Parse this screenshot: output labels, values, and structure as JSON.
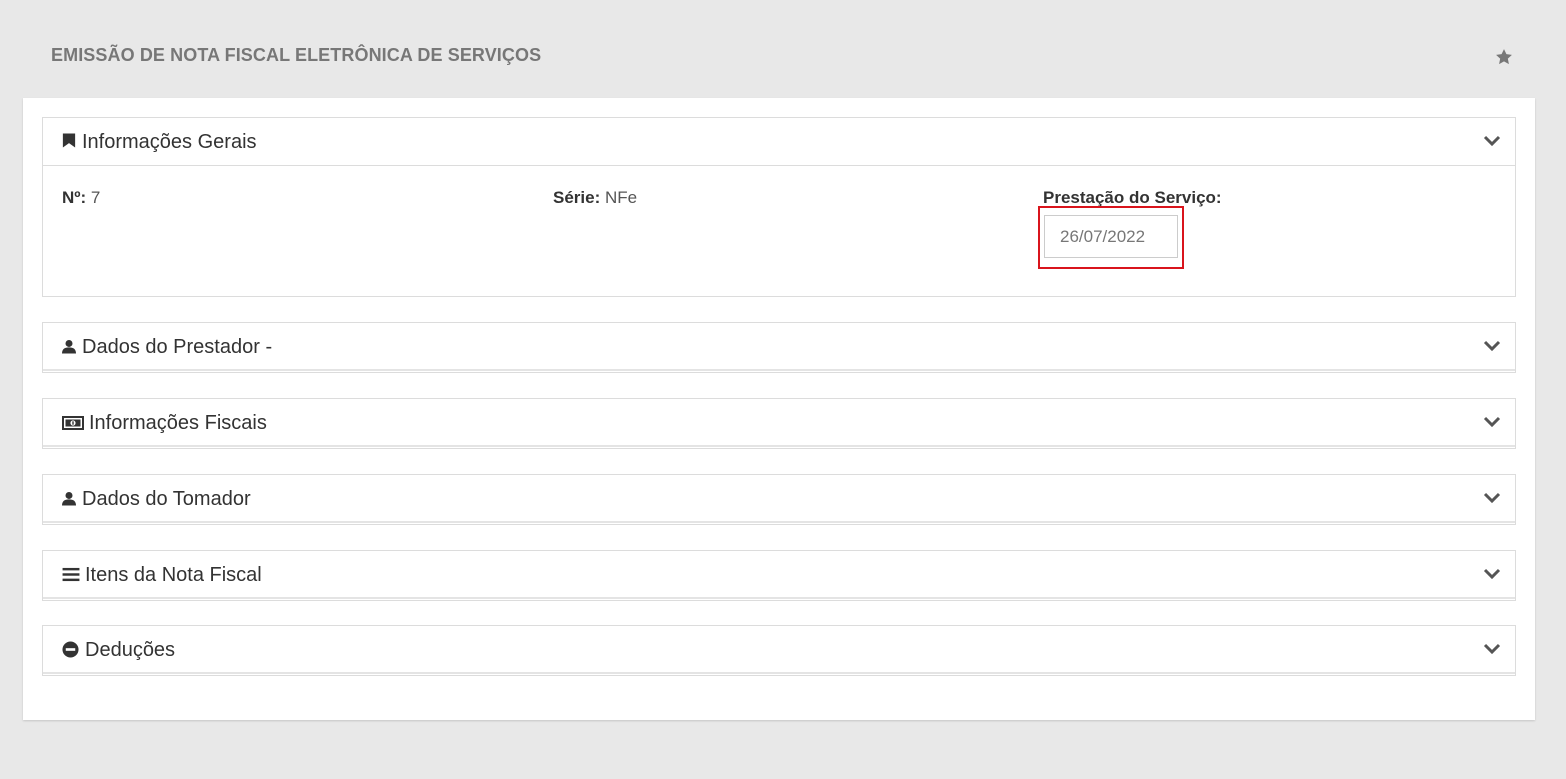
{
  "page": {
    "title": "EMISSÃO DE NOTA FISCAL ELETRÔNICA DE SERVIÇOS",
    "favorite_icon": "star-icon"
  },
  "panels": [
    {
      "label": "Informações Gerais",
      "icon": "bookmark-icon",
      "expanded": true,
      "fields": {
        "numero_label": "Nº:",
        "numero_value": "7",
        "serie_label": "Série:",
        "serie_value": "NFe",
        "prestacao_label": "Prestação do Serviço:",
        "prestacao_value": "26/07/2022"
      }
    },
    {
      "label": "Dados do Prestador -",
      "icon": "user-icon",
      "expanded": false
    },
    {
      "label": "Informações Fiscais",
      "icon": "money-icon",
      "expanded": false
    },
    {
      "label": "Dados do Tomador",
      "icon": "user-icon",
      "expanded": false
    },
    {
      "label": "Itens da Nota Fiscal",
      "icon": "list-icon",
      "expanded": false
    },
    {
      "label": "Deduções",
      "icon": "minus-circle-icon",
      "expanded": false
    }
  ],
  "colors": {
    "background": "#e8e8e8",
    "title": "#777777",
    "highlight": "#d9141c"
  }
}
